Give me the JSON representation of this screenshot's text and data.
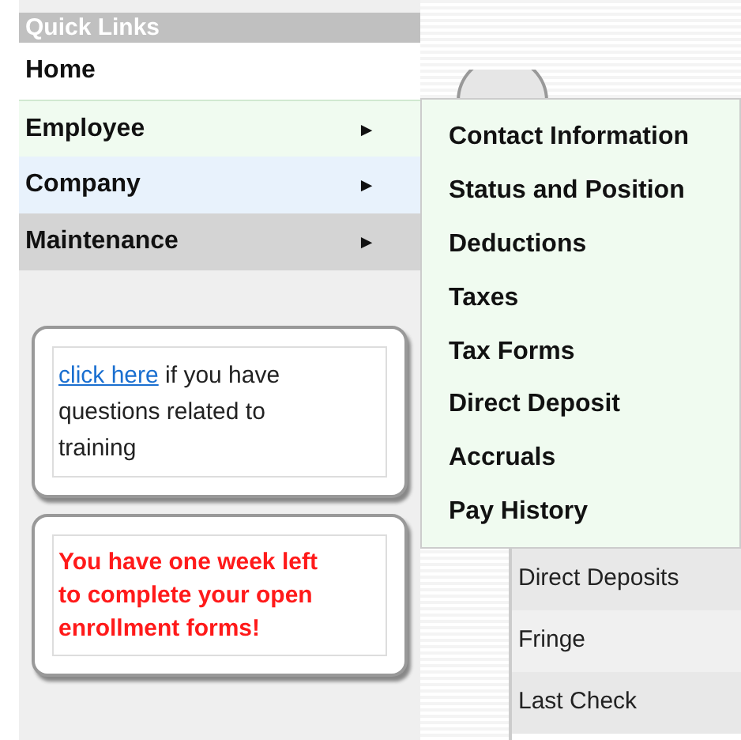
{
  "sidebar": {
    "title": "Quick Links",
    "items": [
      {
        "label": "Home",
        "color": "#ffffff",
        "expanded": false
      },
      {
        "label": "Employee",
        "arrow": "►",
        "color": "#f0fbf0",
        "expanded": true
      },
      {
        "label": "Company",
        "arrow": "►",
        "color": "#e8f2fc",
        "expanded": false
      },
      {
        "label": "Maintenance",
        "arrow": "►",
        "color": "#d4d4d4",
        "expanded": false
      }
    ],
    "notices": [
      {
        "kind": "link",
        "link": "click here",
        "text": " if you have questions related to training"
      },
      {
        "kind": "alert",
        "text": "You have one week left to complete your open enrollment forms!"
      }
    ]
  },
  "submenu": {
    "items": [
      "Contact Information",
      "Status and Position",
      "Deductions",
      "Taxes",
      "Tax Forms",
      "Direct Deposit",
      "Accruals",
      "Pay History"
    ]
  },
  "background_list": {
    "items": [
      "Direct Deposits",
      "Fringe",
      "Last Check"
    ]
  }
}
